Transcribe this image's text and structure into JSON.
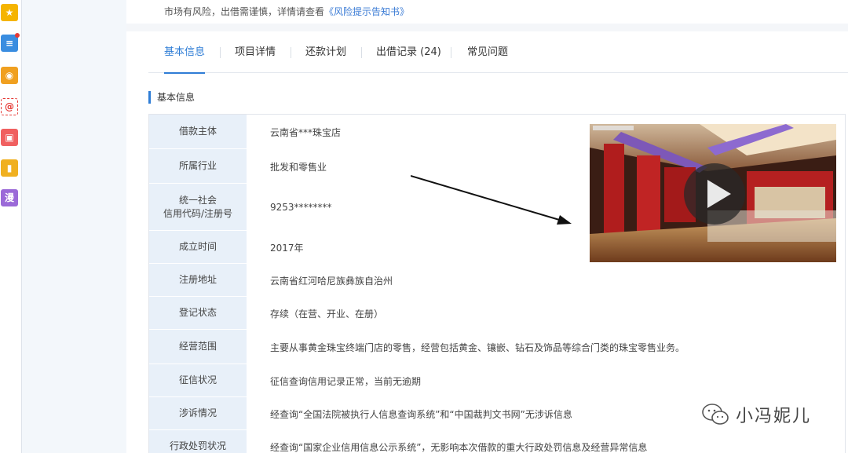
{
  "rail": {
    "items": [
      {
        "icon": "star-icon",
        "glyph": "★",
        "color": "#f5b400"
      },
      {
        "icon": "list-icon",
        "glyph": "≡",
        "color": "#3a8de0"
      },
      {
        "icon": "weibo-icon",
        "glyph": "◉",
        "color": "#f0a020"
      },
      {
        "icon": "mail-icon",
        "glyph": "@",
        "color": "#ffffff"
      },
      {
        "icon": "game-icon",
        "glyph": "▣",
        "color": "#f06060"
      },
      {
        "icon": "book-icon",
        "glyph": "▮",
        "color": "#f0b020"
      },
      {
        "icon": "comic-icon",
        "glyph": "漫",
        "color": "#9b6ad8"
      }
    ]
  },
  "risk_notice": {
    "text": "市场有风险，出借需谨慎，详情请查看",
    "link": "《风险提示告知书》"
  },
  "tabs": [
    {
      "label": "基本信息",
      "active": true
    },
    {
      "label": "项目详情",
      "active": false
    },
    {
      "label": "还款计划",
      "active": false
    },
    {
      "label": "出借记录 (24)",
      "active": false
    },
    {
      "label": "常见问题",
      "active": false
    }
  ],
  "section": {
    "title": "基本信息"
  },
  "info_rows": [
    {
      "label": "借款主体",
      "value": "云南省***珠宝店"
    },
    {
      "label": "所属行业",
      "value": "批发和零售业"
    },
    {
      "label": "统一社会\n信用代码/注册号",
      "value": "9253********"
    },
    {
      "label": "成立时间",
      "value": "2017年"
    },
    {
      "label": "注册地址",
      "value": "云南省红河哈尼族彝族自治州"
    },
    {
      "label": "登记状态",
      "value": "存续（在营、开业、在册）"
    },
    {
      "label": "经营范围",
      "value": "主要从事黄金珠宝终端门店的零售，经营包括黄金、镶嵌、钻石及饰品等综合门类的珠宝零售业务。"
    },
    {
      "label": "征信状况",
      "value": "征信查询信用记录正常，当前无逾期"
    },
    {
      "label": "涉诉情况",
      "value": "经查询“全国法院被执行人信息查询系统”和“中国裁判文书网”无涉诉信息"
    },
    {
      "label": "行政处罚状况",
      "value": "经查询“国家企业信用信息公示系统”，无影响本次借款的重大行政处罚信息及经营异常信息"
    }
  ],
  "video": {
    "icon": "play-icon"
  },
  "watermark": {
    "text": "小冯妮儿",
    "icon": "wechat-icon"
  }
}
